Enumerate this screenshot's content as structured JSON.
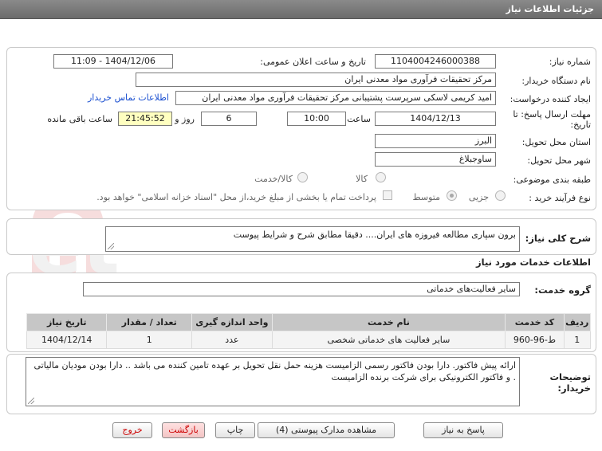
{
  "header": {
    "title": "جزئیات اطلاعات نیاز"
  },
  "form": {
    "need_number_label": "شماره نیاز:",
    "need_number": "1104004246000388",
    "announce_label": "تاریخ و ساعت اعلان عمومی:",
    "announce_value": "1404/12/06 - 11:09",
    "buyer_org_label": "نام دستگاه خریدار:",
    "buyer_org": "مرکز تحقیقات فرآوری مواد معدنی ایران",
    "requester_label": "ایجاد کننده درخواست:",
    "requester": "امید کریمی لاسکی سرپرست پشتیبانی مرکز تحقیقات فرآوری مواد معدنی ایران",
    "contact_link": "اطلاعات تماس خریدار",
    "deadline_label_1": "مهلت ارسال پاسخ: تا",
    "deadline_label_2": "تاریخ:",
    "deadline_date": "1404/12/13",
    "time_label": "ساعت",
    "deadline_time": "10:00",
    "days_value": "6",
    "days_label": "روز و",
    "remaining_time": "21:45:52",
    "remaining_label": "ساعت باقی مانده",
    "province_label": "استان محل تحویل:",
    "province": "البرز",
    "city_label": "شهر محل تحویل:",
    "city": "ساوجبلاغ",
    "category_label": "طبقه بندی موضوعی:",
    "category_options": [
      "کالا",
      "کالا/خدمت"
    ],
    "process_label": "نوع فرآیند خرید :",
    "process_options": [
      "جزیی",
      "متوسط"
    ],
    "payment_text": "پرداخت تمام یا بخشی از مبلغ خرید،از محل \"اسناد خزانه اسلامی\" خواهد بود."
  },
  "summary": {
    "label": "شرح کلی نیاز:",
    "text": "برون سپاری مطالعه فیروزه های ایران.... دقیقا مطابق شرح و شرایط پیوست"
  },
  "services": {
    "section_title": "اطلاعات خدمات مورد نیاز",
    "group_label": "گروه خدمت:",
    "group_value": "سایر فعالیت‌های خدماتی",
    "columns": [
      "ردیف",
      "کد خدمت",
      "نام خدمت",
      "واحد اندازه گیری",
      "تعداد / مقدار",
      "تاریخ نیاز"
    ],
    "rows": [
      {
        "row": "1",
        "code": "ط-96-960",
        "name": "سایر فعالیت های خدماتی شخصی",
        "unit": "عدد",
        "qty": "1",
        "date": "1404/12/14"
      }
    ]
  },
  "buyer_notes": {
    "label_1": "توضیحات",
    "label_2": "خریدار:",
    "text": "ارائه پیش فاکتور. دارا بودن فاکتور رسمی الزامیست هزینه حمل نقل تحویل بر عهده تامین کننده می باشد .. دارا بودن مودیان مالیاتی . و فاکتور الکترونیکی برای شرکت برنده الزامیست"
  },
  "buttons": {
    "reply": "پاسخ به نیاز",
    "attachments": "مشاهده مدارک پیوستی (4)",
    "print": "چاپ",
    "back": "بازگشت",
    "exit": "خروج"
  },
  "watermark": {
    "text": "AriaTender.net"
  },
  "colors": {
    "title_bg": "#7a7a7a",
    "timer_bg": "#ffffc0",
    "link": "#1a4fd0",
    "exit": "#cc0000"
  }
}
